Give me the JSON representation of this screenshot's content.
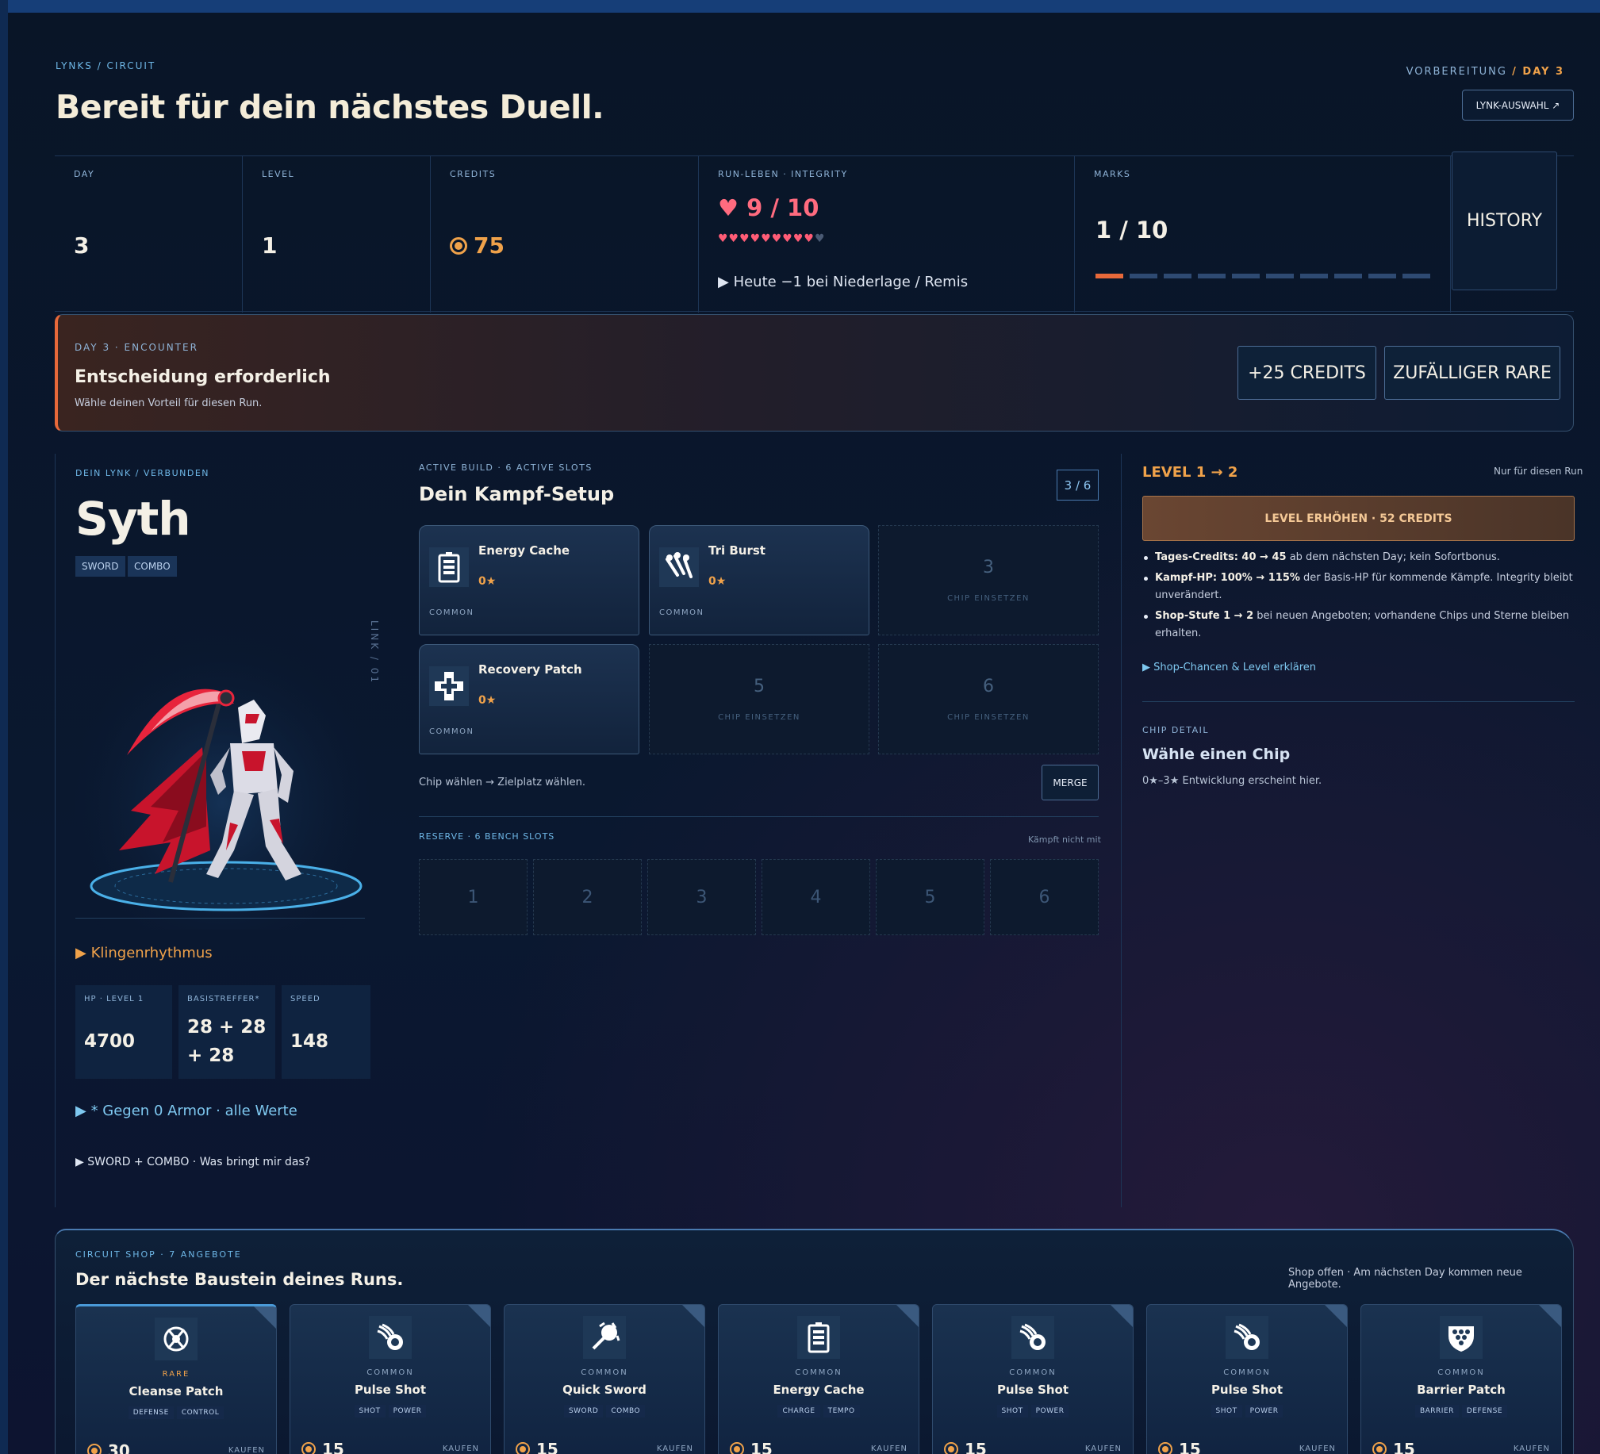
{
  "header": {
    "breadcrumb": "LYNKS / CIRCUIT",
    "title": "Bereit für dein nächstes Duell.",
    "stage_prefix": "VORBEREITUNG",
    "stage_day": "/ DAY 3",
    "lynk_select_label": "LYNK-AUSWAHL ↗"
  },
  "stats": {
    "day_label": "DAY",
    "day_value": "3",
    "level_label": "LEVEL",
    "level_value": "1",
    "credits_label": "CREDITS",
    "credits_value": "75",
    "lives_label": "RUN-LEBEN · INTEGRITY",
    "lives_value": "♥ 9 / 10",
    "hearts_on": "♥♥♥♥♥♥♥♥♥",
    "hearts_off": "♥",
    "lives_note": "▶ Heute −1 bei Niederlage / Remis",
    "marks_label": "MARKS",
    "marks_value": "1 / 10",
    "marks_filled": 1,
    "marks_total": 10,
    "history_label": "HISTORY"
  },
  "encounter": {
    "label": "DAY 3 · ENCOUNTER",
    "title": "Entscheidung erforderlich",
    "subtitle": "Wähle deinen Vorteil für diesen Run.",
    "option_credits": "+25 CREDITS",
    "option_rare": "ZUFÄLLIGER RARE"
  },
  "lynk": {
    "label": "DEIN LYNK / VERBUNDEN",
    "name": "Syth",
    "tags": [
      "SWORD",
      "COMBO"
    ],
    "side_text": "LINK / 01",
    "ability": "▶ Klingenrhythmus",
    "hp_label": "HP · LEVEL 1",
    "hp_value": "4700",
    "base_label": "BASISTREFFER*",
    "base_value_1": "28 + 28",
    "base_value_2": "+ 28",
    "speed_label": "SPEED",
    "speed_value": "148",
    "armor_note": "▶ * Gegen 0 Armor · alle Werte",
    "synergy_note": "▶ SWORD + COMBO · Was bringt mir das?"
  },
  "build": {
    "label": "ACTIVE BUILD · 6 ACTIVE SLOTS",
    "title": "Dein Kampf-Setup",
    "slot_count": "3 / 6",
    "chips": [
      {
        "name": "Energy Cache",
        "stars": "0★",
        "rarity": "COMMON",
        "icon": "battery-icon"
      },
      {
        "name": "Tri Burst",
        "stars": "0★",
        "rarity": "COMMON",
        "icon": "tri-burst-icon"
      },
      {
        "name": "Recovery Patch",
        "stars": "0★",
        "rarity": "COMMON",
        "icon": "medical-cross-icon"
      }
    ],
    "empty_slots": [
      {
        "number": "3",
        "text": "CHIP EINSETZEN"
      },
      {
        "number": "5",
        "text": "CHIP EINSETZEN"
      },
      {
        "number": "6",
        "text": "CHIP EINSETZEN"
      }
    ],
    "hint": "Chip wählen → Zielplatz wählen.",
    "merge_label": "MERGE",
    "reserve_label": "RESERVE · 6 BENCH SLOTS",
    "reserve_note": "Kämpft nicht mit",
    "bench": [
      "1",
      "2",
      "3",
      "4",
      "5",
      "6"
    ]
  },
  "level_panel": {
    "title": "LEVEL 1 → 2",
    "note": "Nur für diesen Run",
    "button": "LEVEL ERHÖHEN · 52 CREDITS",
    "items": [
      {
        "bold": "Tages-Credits: 40 → 45",
        "text": " ab dem nächsten Day; kein Sofortbonus."
      },
      {
        "bold": "Kampf-HP: 100% → 115%",
        "text": " der Basis-HP für kommende Kämpfe. Integrity bleibt unverändert."
      },
      {
        "bold": "Shop-Stufe 1 → 2",
        "text": " bei neuen Angeboten; vorhandene Chips und Sterne bleiben erhalten."
      }
    ],
    "shop_link": "▶ Shop-Chancen & Level erklären",
    "chip_detail_label": "CHIP DETAIL",
    "chip_detail_title": "Wähle einen Chip",
    "chip_detail_sub": "0★–3★ Entwicklung erscheint hier."
  },
  "shop": {
    "label": "CIRCUIT SHOP · 7 ANGEBOTE",
    "title": "Der nächste Baustein deines Runs.",
    "note": "Shop offen · Am nächsten Day kommen neue Angebote.",
    "buy_label": "KAUFEN",
    "cards": [
      {
        "rarity": "RARE",
        "name": "Cleanse Patch",
        "tags": [
          "DEFENSE",
          "CONTROL"
        ],
        "price": "30",
        "icon": "cleanse-icon"
      },
      {
        "rarity": "COMMON",
        "name": "Pulse Shot",
        "tags": [
          "SHOT",
          "POWER"
        ],
        "price": "15",
        "icon": "pulse-icon"
      },
      {
        "rarity": "COMMON",
        "name": "Quick Sword",
        "tags": [
          "SWORD",
          "COMBO"
        ],
        "price": "15",
        "icon": "sword-icon"
      },
      {
        "rarity": "COMMON",
        "name": "Energy Cache",
        "tags": [
          "CHARGE",
          "TEMPO"
        ],
        "price": "15",
        "icon": "battery-icon"
      },
      {
        "rarity": "COMMON",
        "name": "Pulse Shot",
        "tags": [
          "SHOT",
          "POWER"
        ],
        "price": "15",
        "icon": "pulse-icon"
      },
      {
        "rarity": "COMMON",
        "name": "Pulse Shot",
        "tags": [
          "SHOT",
          "POWER"
        ],
        "price": "15",
        "icon": "pulse-icon"
      },
      {
        "rarity": "COMMON",
        "name": "Barrier Patch",
        "tags": [
          "BARRIER",
          "DEFENSE"
        ],
        "price": "15",
        "icon": "barrier-icon"
      }
    ]
  }
}
